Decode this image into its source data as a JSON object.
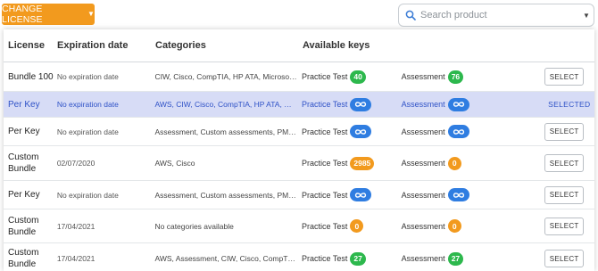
{
  "toolbar": {
    "change_license_label": "CHANGE LICENSE",
    "search_placeholder": "Search product"
  },
  "table": {
    "headers": {
      "license": "License",
      "expiration": "Expiration date",
      "categories": "Categories",
      "available_keys": "Available keys"
    },
    "practice_test_label": "Practice Test",
    "assessment_label": "Assessment",
    "select_label": "SELECT",
    "selected_label": "SELECTED",
    "rows": [
      {
        "license": "Bundle 100",
        "expiration": "No expiration date",
        "categories": "CIW, Cisco, CompTIA, HP ATA, Microsoft, ...",
        "pt": "40",
        "pt_color": "green",
        "as": "76",
        "as_color": "green",
        "selected": false
      },
      {
        "license": "Per Key",
        "expiration": "No expiration date",
        "categories": "AWS, CIW, Cisco, CompTIA, HP ATA, Microsoft, ...",
        "pt": "∞",
        "pt_color": "blue",
        "as": "∞",
        "as_color": "blue",
        "selected": true
      },
      {
        "license": "Per Key",
        "expiration": "No expiration date",
        "categories": "Assessment, Custom assessments, PMI, ...",
        "pt": "∞",
        "pt_color": "blue",
        "as": "∞",
        "as_color": "blue",
        "selected": false
      },
      {
        "license": "Custom Bundle",
        "expiration": "02/07/2020",
        "categories": "AWS, Cisco",
        "pt": "2985",
        "pt_color": "orange",
        "as": "0",
        "as_color": "orange",
        "selected": false
      },
      {
        "license": "Per Key",
        "expiration": "No expiration date",
        "categories": "Assessment, Custom assessments, PMI, ...",
        "pt": "∞",
        "pt_color": "blue",
        "as": "∞",
        "as_color": "blue",
        "selected": false
      },
      {
        "license": "Custom Bundle",
        "expiration": "17/04/2021",
        "categories": "No categories available",
        "pt": "0",
        "pt_color": "orange",
        "as": "0",
        "as_color": "orange",
        "selected": false
      },
      {
        "license": "Custom Bundle",
        "expiration": "17/04/2021",
        "categories": "AWS, Assessment, CIW, Cisco, CompTIA, ...",
        "pt": "27",
        "pt_color": "green",
        "as": "27",
        "as_color": "green",
        "selected": false
      }
    ]
  },
  "colors": {
    "accent_orange": "#f29a1e",
    "green": "#2db84d",
    "blue": "#2f7de1",
    "selected_row": "#d7dcf6",
    "selected_text": "#2f52c7"
  },
  "icons": {
    "dropdown": "chevron-down-icon",
    "search": "search-icon",
    "unlimited": "infinity-icon"
  }
}
